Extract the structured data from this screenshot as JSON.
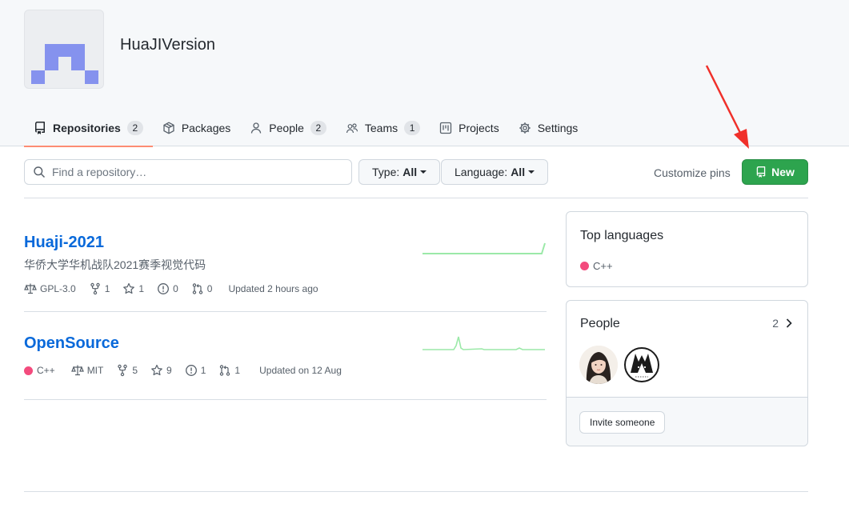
{
  "org": {
    "name": "HuaJIVersion",
    "logo_color": "#8592ee"
  },
  "tabs": [
    {
      "label": "Repositories",
      "count": "2",
      "icon": "repo-icon",
      "active": true
    },
    {
      "label": "Packages",
      "icon": "package-icon"
    },
    {
      "label": "People",
      "count": "2",
      "icon": "person-icon"
    },
    {
      "label": "Teams",
      "count": "1",
      "icon": "people-icon"
    },
    {
      "label": "Projects",
      "icon": "project-icon"
    },
    {
      "label": "Settings",
      "icon": "gear-icon"
    }
  ],
  "toolbar": {
    "search_placeholder": "Find a repository…",
    "type_label": "Type:",
    "type_value": "All",
    "language_label": "Language:",
    "language_value": "All",
    "customize_label": "Customize pins",
    "new_label": "New"
  },
  "repos": [
    {
      "name": "Huaji-2021",
      "description": "华侨大学华机战队2021赛季视觉代码",
      "license": "GPL-3.0",
      "forks": "1",
      "stars": "1",
      "issues": "0",
      "pulls": "0",
      "updated": "Updated 2 hours ago"
    },
    {
      "name": "OpenSource",
      "language": "C++",
      "language_color": "#f34b7d",
      "license": "MIT",
      "forks": "5",
      "stars": "9",
      "issues": "1",
      "pulls": "1",
      "updated": "Updated on 12 Aug"
    }
  ],
  "sidebar": {
    "top_languages_title": "Top languages",
    "top_language": "C++",
    "top_language_color": "#f34b7d",
    "people_title": "People",
    "people_count": "2",
    "invite_label": "Invite someone"
  },
  "colors": {
    "accent_green": "#2da44e",
    "link_blue": "#0969da",
    "annotation_red": "#f0302a"
  }
}
